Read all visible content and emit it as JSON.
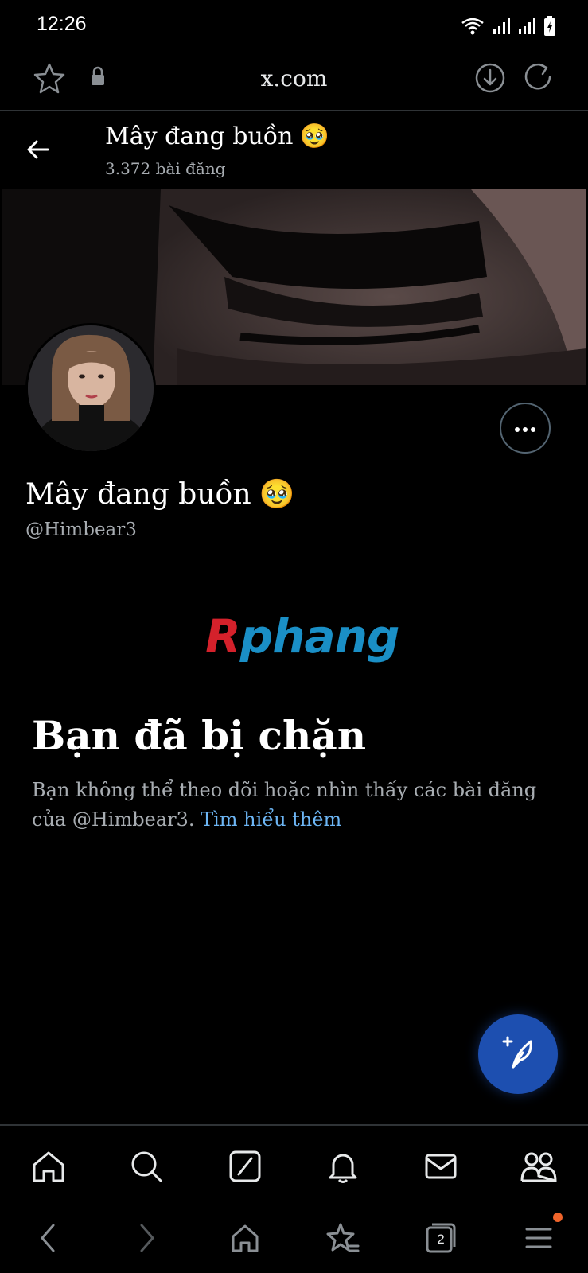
{
  "status": {
    "time": "12:26",
    "icons": [
      "wifi-icon",
      "signal-icon",
      "signal-icon",
      "battery-charging-icon"
    ]
  },
  "browser": {
    "url": "x.com",
    "icons": [
      "star-icon",
      "lock-icon",
      "download-icon",
      "reload-icon"
    ]
  },
  "header": {
    "name": "Mây đang buồn",
    "emoji": "🥹",
    "post_count": "3.372 bài đăng"
  },
  "profile": {
    "name": "Mây đang buồn",
    "emoji": "🥹",
    "handle": "@Himbear3"
  },
  "watermark": {
    "first": "R",
    "rest": "phang"
  },
  "blocked": {
    "title": "Bạn đã bị chặn",
    "description": "Bạn không thể theo dõi hoặc nhìn thấy các bài đăng của @Himbear3.",
    "link": "Tìm hiểu thêm"
  },
  "bottom_nav": [
    "home-icon",
    "search-icon",
    "grok-icon",
    "notifications-icon",
    "messages-icon",
    "communities-icon"
  ],
  "browser_nav": {
    "icons": [
      "back-icon",
      "forward-icon",
      "home-icon",
      "bookmarks-icon",
      "tabs-icon",
      "menu-icon"
    ],
    "tabs_count": "2"
  },
  "colors": {
    "accent": "#1d4fb0",
    "link": "#6db6f5",
    "notification_dot": "#f0642a"
  }
}
